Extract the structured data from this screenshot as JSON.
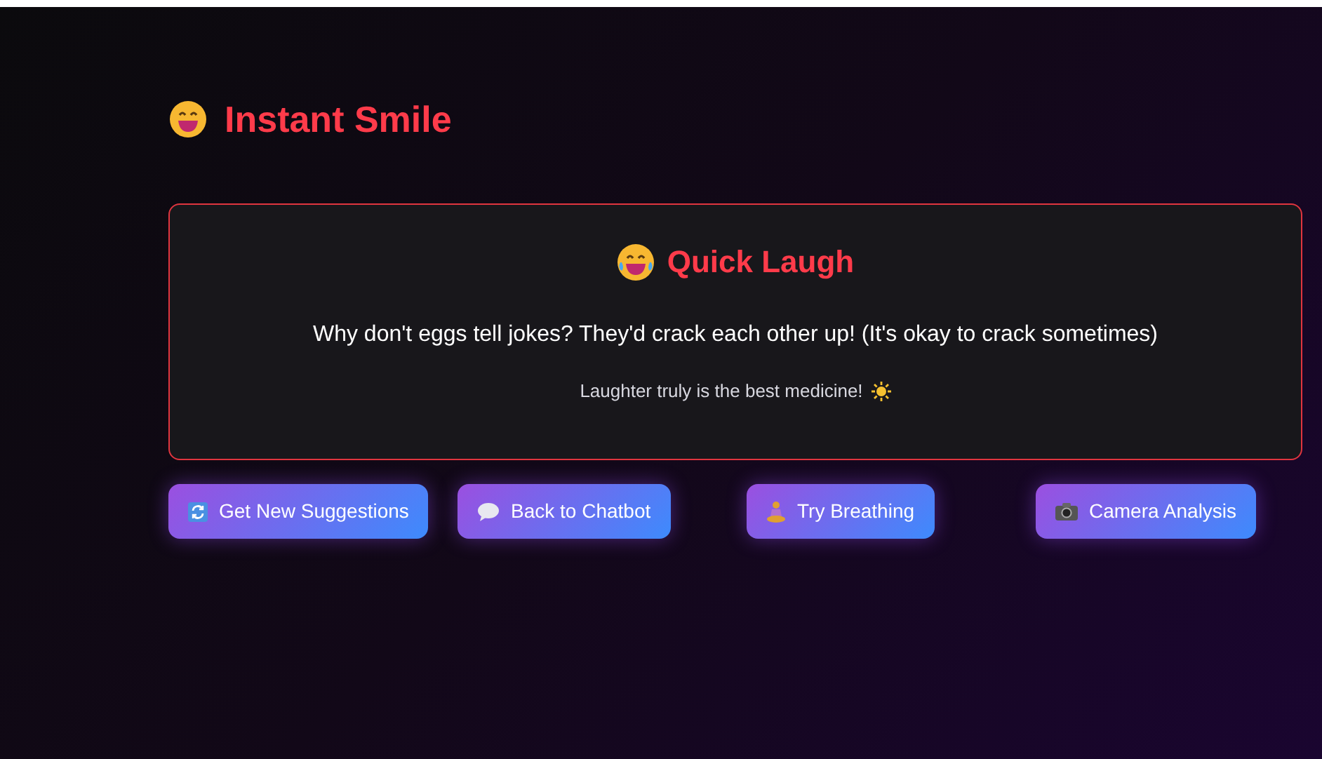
{
  "title": "Instant Smile",
  "card": {
    "title": "Quick Laugh",
    "joke": "Why don't eggs tell jokes? They'd crack each other up! (It's okay to crack sometimes)",
    "note": "Laughter truly is the best medicine!"
  },
  "buttons": [
    {
      "label": "Get New Suggestions",
      "kind": "refresh"
    },
    {
      "label": "Back to Chatbot",
      "kind": "chat"
    },
    {
      "label": "Try Breathing",
      "kind": "meditate"
    },
    {
      "label": "Camera Analysis",
      "kind": "camera"
    }
  ]
}
